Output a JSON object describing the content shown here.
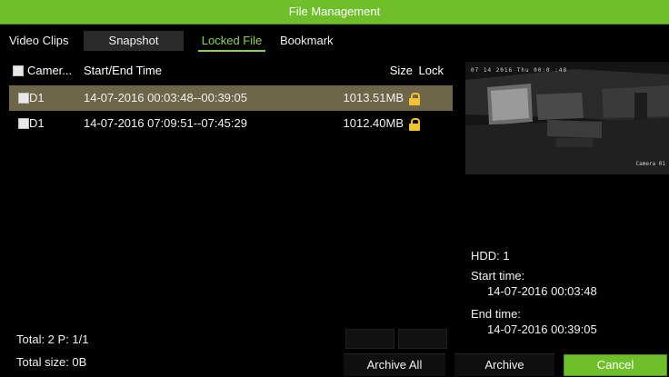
{
  "window": {
    "title": "File Management"
  },
  "tabs": [
    {
      "label": "Video Clips"
    },
    {
      "label": "Snapshot"
    },
    {
      "label": "Locked File"
    },
    {
      "label": "Bookmark"
    }
  ],
  "list": {
    "headers": {
      "camera": "Camer...",
      "time": "Start/End Time",
      "size": "Size",
      "lock": "Lock"
    },
    "rows": [
      {
        "camera": "D1",
        "time": "14-07-2016 00:03:48--00:39:05",
        "size": "1013.51MB",
        "locked": true
      },
      {
        "camera": "D1",
        "time": "14-07-2016 07:09:51--07:45:29",
        "size": "1012.40MB",
        "locked": true
      }
    ]
  },
  "preview": {
    "timestamp_osd": "07 14 2016 Thu 00:0 :48",
    "camera_osd": "Camera 01"
  },
  "info": {
    "hdd": "HDD: 1",
    "start_label": "Start time:",
    "start_value": "14-07-2016 00:03:48",
    "end_label": "End time:",
    "end_value": "14-07-2016 00:39:05"
  },
  "footer": {
    "total": "Total: 2  P: 1/1",
    "total_size": "Total size: 0B"
  },
  "buttons": {
    "archive_all": "Archive All",
    "archive": "Archive",
    "cancel": "Cancel"
  },
  "colors": {
    "accent": "#6fbf2a",
    "selected_row": "#6e6648",
    "lock": "#f1c232"
  }
}
